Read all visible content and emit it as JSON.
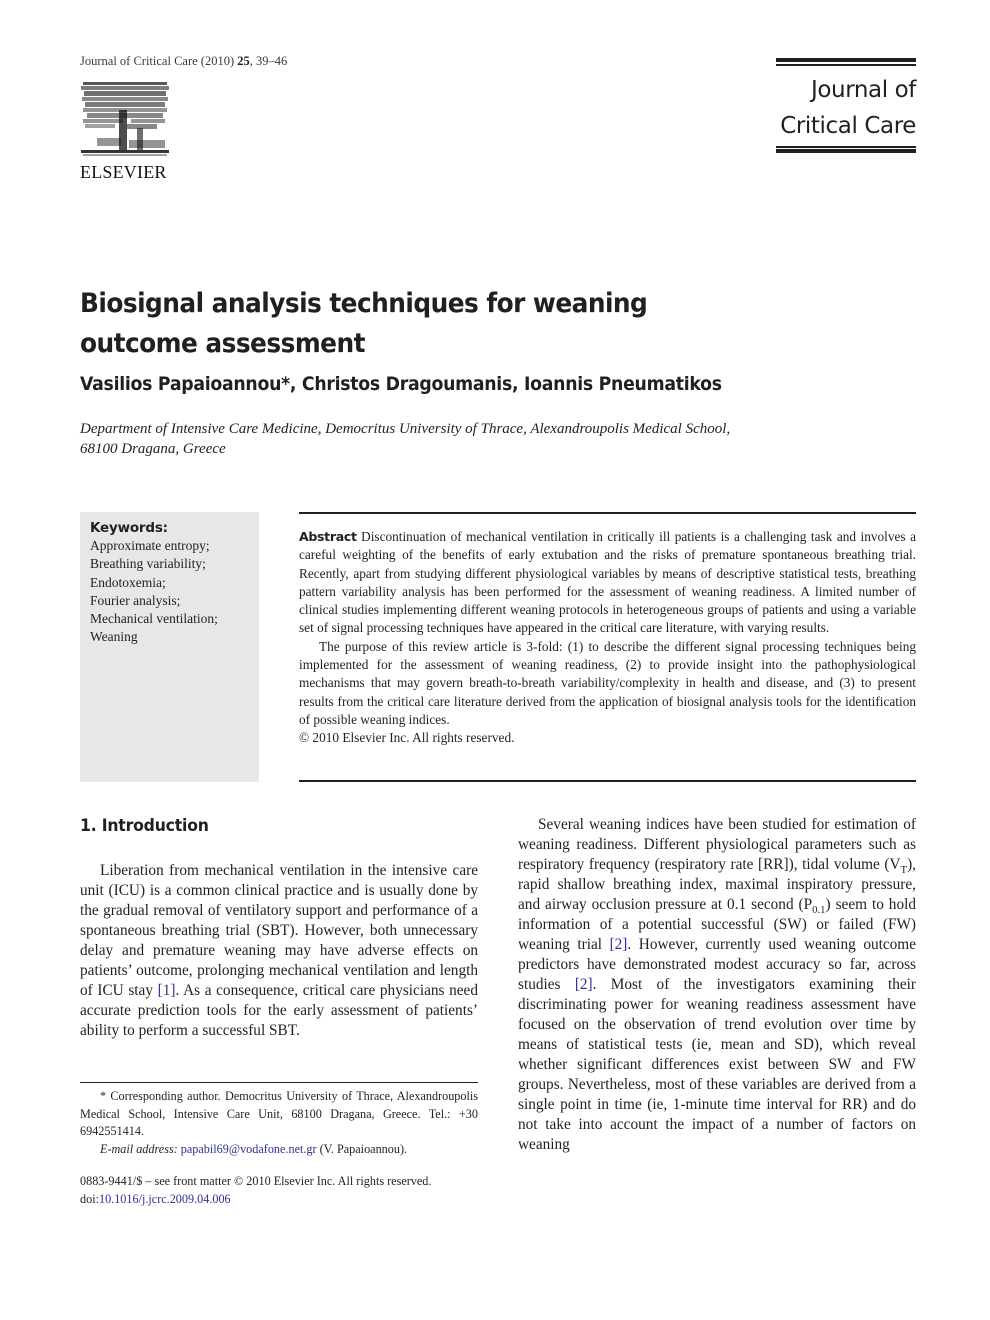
{
  "header": {
    "citation_journal": "Journal of Critical Care (2010) ",
    "citation_volume": "25",
    "citation_pages": ", 39–46",
    "publisher_logo_icon": "elsevier-tree-icon",
    "publisher_name": "ELSEVIER",
    "journal_title_line1": "Journal of",
    "journal_title_line2": "Critical Care"
  },
  "article": {
    "title": "Biosignal analysis techniques for weaning outcome assessment",
    "authors": "Vasilios Papaioannou*, Christos Dragoumanis, Ioannis Pneumatikos",
    "affiliation_line1": "Department of Intensive Care Medicine, Democritus University of Thrace, Alexandroupolis Medical School,",
    "affiliation_line2": "68100 Dragana, Greece"
  },
  "keywords": {
    "title": "Keywords:",
    "items": [
      "Approximate entropy;",
      "Breathing variability;",
      "Endotoxemia;",
      "Fourier analysis;",
      "Mechanical ventilation;",
      "Weaning"
    ]
  },
  "abstract": {
    "label": "Abstract",
    "paragraph1": " Discontinuation of mechanical ventilation in critically ill patients is a challenging task and involves a careful weighting of the benefits of early extubation and the risks of premature spontaneous breathing trial. Recently, apart from studying different physiological variables by means of descriptive statistical tests, breathing pattern variability analysis has been performed for the assessment of weaning readiness. A limited number of clinical studies implementing different weaning protocols in heterogeneous groups of patients and using a variable set of signal processing techniques have appeared in the critical care literature, with varying results.",
    "paragraph2": "The purpose of this review article is 3-fold: (1) to describe the different signal processing techniques being implemented for the assessment of weaning readiness, (2) to provide insight into the pathophysiological mechanisms that may govern breath-to-breath variability/complexity in health and disease, and (3) to present results from the critical care literature derived from the application of biosignal analysis tools for the identification of possible weaning indices.",
    "copyright": "© 2010 Elsevier Inc. All rights reserved."
  },
  "introduction": {
    "heading": "1. Introduction",
    "left_p1_a": "Liberation from mechanical ventilation in the intensive care unit (ICU) is a common clinical practice and is usually done by the gradual removal of ventilatory support and performance of a spontaneous breathing trial (SBT). However, both unnecessary delay and premature weaning may have adverse effects on patients’ outcome, prolonging mechanical ventilation and length of ICU stay ",
    "left_p1_ref1": "[1]",
    "left_p1_b": ". As a consequence, critical care physicians need accurate prediction tools for the early assessment of patients’ ability to perform a successful SBT.",
    "right_p1_a": "Several weaning indices have been studied for estimation of weaning readiness. Different physiological parameters such as respiratory frequency (respiratory rate [RR]), tidal volume (V",
    "right_p1_sub_t": "T",
    "right_p1_b": "), rapid shallow breathing index, maximal inspiratory pressure, and airway occlusion pressure at 0.1 second (P",
    "right_p1_sub_01": "0.1",
    "right_p1_c": ") seem to hold information of a potential successful (SW) or failed (FW) weaning trial ",
    "right_p1_ref2a": "[2]",
    "right_p1_d": ". However, currently used weaning outcome predictors have demonstrated modest accuracy so far, across studies ",
    "right_p1_ref2b": "[2]",
    "right_p1_e": ". Most of the investigators examining their discriminating power for weaning readiness assessment have focused on the observation of trend evolution over time by means of statistical tests (ie, mean and SD), which reveal whether significant differences exist between SW and FW groups. Nevertheless, most of these variables are derived from a single point in time (ie, 1-minute time interval for RR) and do not take into account the impact of a number of factors on weaning"
  },
  "footnote": {
    "corresponding": "* Corresponding author. Democritus University of Thrace, Alexandroupolis Medical School, Intensive Care Unit, 68100 Dragana, Greece. Tel.: +30 6942551414.",
    "email_label": "E-mail address:",
    "email": "papabil69@vodafone.net.gr",
    "email_suffix": " (V. Papaioannou).",
    "issn_line": "0883-9441/$ – see front matter © 2010 Elsevier Inc. All rights reserved.",
    "doi_prefix": "doi:",
    "doi": "10.1016/j.jcrc.2009.04.006"
  },
  "colors": {
    "text": "#231f20",
    "link": "#2e3192",
    "keyword_box_bg": "#e6e7e8"
  }
}
